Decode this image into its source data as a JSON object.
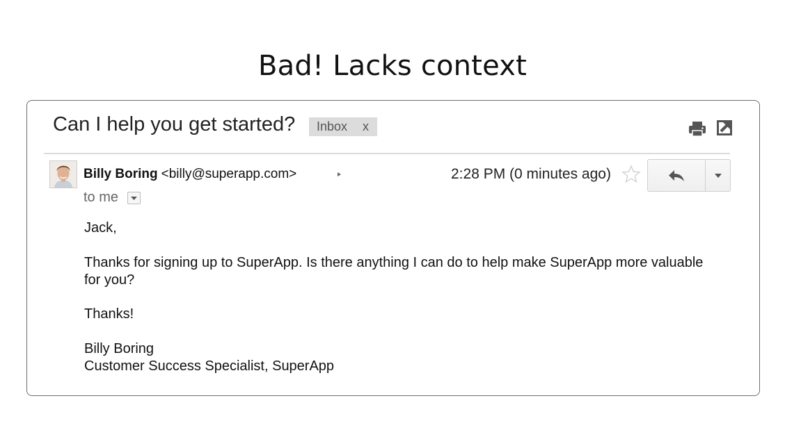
{
  "heading": "Bad! Lacks context",
  "email": {
    "subject": "Can I help you get started?",
    "label_chip": {
      "text": "Inbox",
      "close": "x"
    },
    "sender": {
      "name": "Billy Boring",
      "email": "<billy@superapp.com>"
    },
    "time": "2:28 PM (0 minutes ago)",
    "recipient": "to me",
    "greeting": "Jack,",
    "message": "Thanks for signing up to SuperApp. Is there anything I can do to help make SuperApp more valuable for you?",
    "closing": "Thanks!",
    "signature": {
      "name": "Billy Boring",
      "title": "Customer Success Specialist, SuperApp"
    }
  },
  "icons": {
    "print": "print-icon",
    "popout": "new-window-icon",
    "star": "star-icon",
    "reply": "reply-arrow-icon",
    "more": "caret-down-icon"
  },
  "colors": {
    "chip_bg": "#dcdcdc",
    "panel_border": "#6e6e6e",
    "icon_gray": "#555555"
  }
}
